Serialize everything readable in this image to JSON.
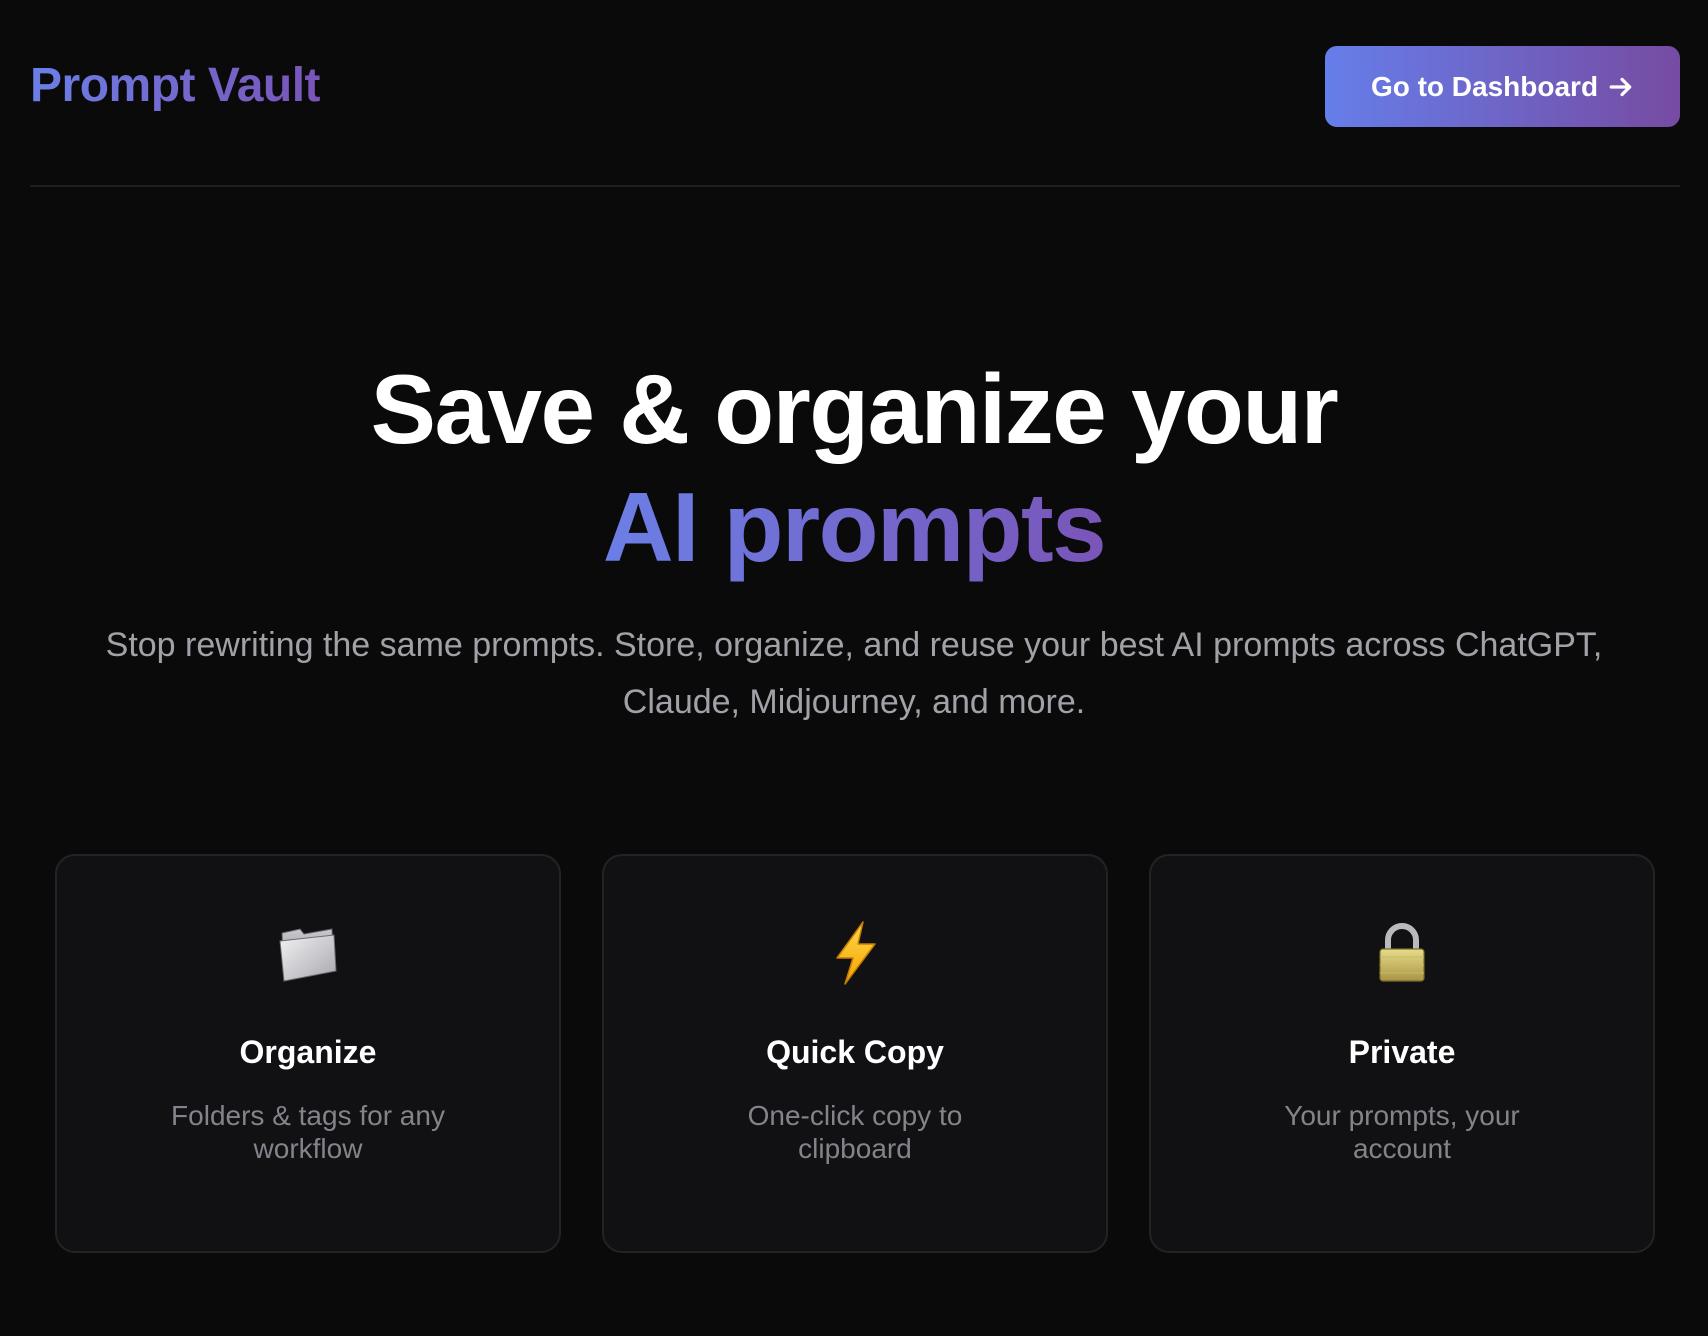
{
  "header": {
    "logo": "Prompt Vault",
    "cta_label": "Go to Dashboard",
    "cta_icon": "arrow-right-icon"
  },
  "hero": {
    "title_line1": "Save & organize your",
    "title_line2": "AI prompts",
    "subtitle": "Stop rewriting the same prompts. Store, organize, and reuse your best AI prompts across ChatGPT, Claude, Midjourney, and more."
  },
  "features": [
    {
      "icon": "folder-icon",
      "title": "Organize",
      "description": "Folders & tags for any workflow"
    },
    {
      "icon": "lightning-icon",
      "title": "Quick Copy",
      "description": "One-click copy to clipboard"
    },
    {
      "icon": "lock-icon",
      "title": "Private",
      "description": "Your prompts, your account"
    }
  ],
  "colors": {
    "background": "#0a0a0b",
    "gradient_start": "#667eea",
    "gradient_end": "#764ba2",
    "card_background": "#111113",
    "muted_text": "#a1a1a8"
  }
}
